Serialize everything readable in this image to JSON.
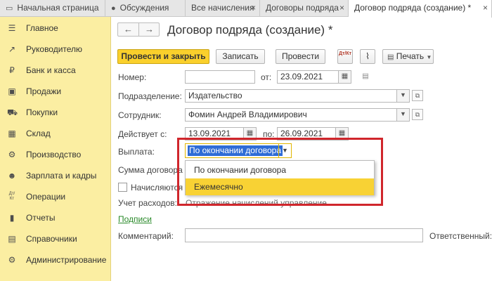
{
  "tabs": [
    {
      "label": "Начальная страница",
      "icon": "home-icon"
    },
    {
      "label": "Обсуждения",
      "icon": "chat-icon"
    },
    {
      "label": "Все начисления",
      "icon": ""
    },
    {
      "label": "Договоры подряда",
      "icon": ""
    },
    {
      "label": "Договор подряда (создание) *",
      "icon": ""
    }
  ],
  "close_glyph": "×",
  "sidebar": {
    "items": [
      {
        "label": "Главное",
        "icon": "menu-icon",
        "glyph": "☰"
      },
      {
        "label": "Руководителю",
        "icon": "trend-icon",
        "glyph": "↗"
      },
      {
        "label": "Банк и касса",
        "icon": "coin-icon",
        "glyph": "₽"
      },
      {
        "label": "Продажи",
        "icon": "bag-icon",
        "glyph": "▣"
      },
      {
        "label": "Покупки",
        "icon": "cart-icon",
        "glyph": "⛟"
      },
      {
        "label": "Склад",
        "icon": "warehouse-icon",
        "glyph": "▦"
      },
      {
        "label": "Производство",
        "icon": "factory-icon",
        "glyph": "⚙"
      },
      {
        "label": "Зарплата и кадры",
        "icon": "people-icon",
        "glyph": "☻"
      },
      {
        "label": "Операции",
        "icon": "dt-kt-icon",
        "glyph": "Дт/Кт"
      },
      {
        "label": "Отчеты",
        "icon": "chart-icon",
        "glyph": "▮"
      },
      {
        "label": "Справочники",
        "icon": "book-icon",
        "glyph": "▤"
      },
      {
        "label": "Администрирование",
        "icon": "gear-icon",
        "glyph": "⚙"
      }
    ]
  },
  "header": {
    "back_glyph": "←",
    "forward_glyph": "→",
    "title": "Договор подряда (создание) *"
  },
  "toolbar": {
    "post_close": "Провести и закрыть",
    "save": "Записать",
    "post": "Провести",
    "dt_kt": "Дт/Кт",
    "attach_glyph": "⌇",
    "print": "Печать"
  },
  "form": {
    "number_label": "Номер:",
    "number_value": "",
    "from_label": "от:",
    "from_value": "23.09.2021",
    "division_label": "Подразделение:",
    "division_value": "Издательство",
    "employee_label": "Сотрудник:",
    "employee_value": "Фомин Андрей Владимирович",
    "valid_label": "Действует с:",
    "valid_from": "13.09.2021",
    "to_label": "по:",
    "valid_to": "26.09.2021",
    "payment_label": "Выплата:",
    "payment_value": "По окончании договора",
    "sum_label": "Сумма договора",
    "accrue_label": "Начисляются в",
    "expense_label": "Учет расходов:",
    "expense_value": "Отражение начислений управление",
    "signatures_link": "Подписи",
    "comment_label": "Комментарий:",
    "comment_value": "",
    "responsible_label": "Ответственный:"
  },
  "dropdown": {
    "options": [
      "По окончании договора",
      "Ежемесячно"
    ],
    "highlighted": 1
  },
  "colors": {
    "sidebar_bg": "#fbeea2",
    "primary_button": "#fad02c",
    "highlight_box": "#d0262c",
    "selected_option": "#f8d234",
    "link": "#2a8a2a"
  }
}
